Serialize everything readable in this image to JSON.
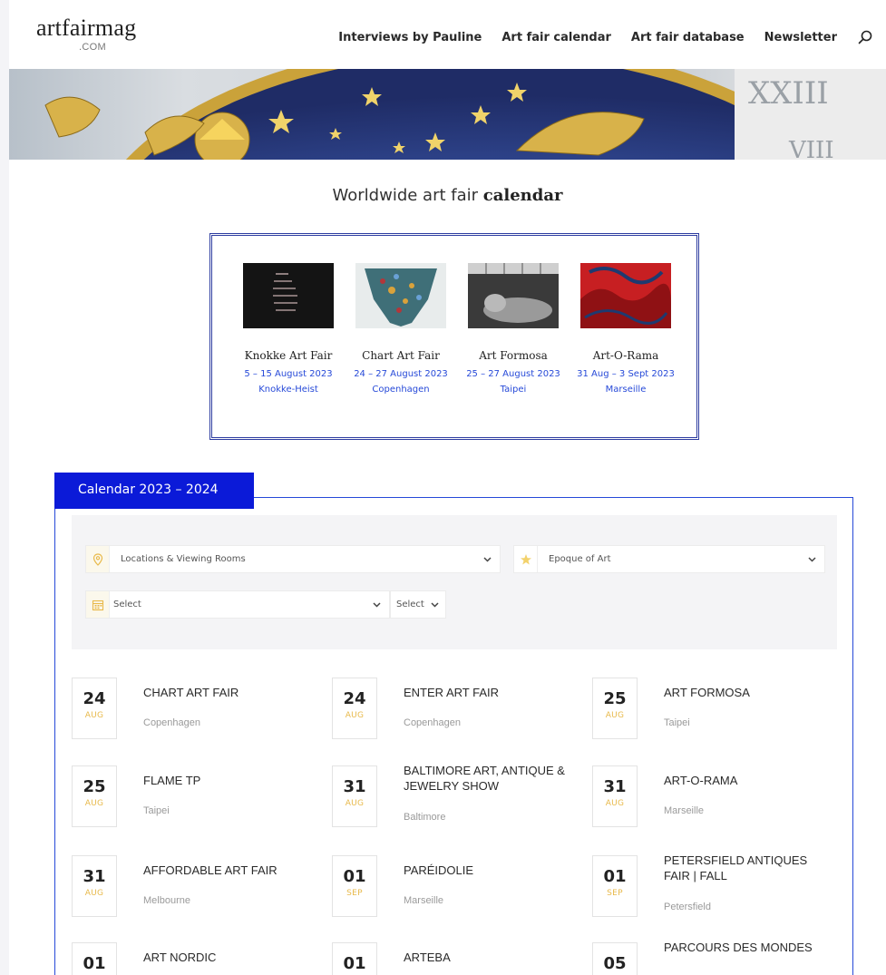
{
  "header": {
    "logo": "artfairmag",
    "logo_sub": ".COM",
    "nav": [
      "Interviews by Pauline",
      "Art fair calendar",
      "Art fair database",
      "Newsletter"
    ]
  },
  "section": {
    "title_prefix": "Worldwide art fair ",
    "title_bold": "calendar"
  },
  "featured": [
    {
      "title": "Knokke Art Fair",
      "dates": "5 – 15 August 2023",
      "location": "Knokke-Heist"
    },
    {
      "title": "Chart Art Fair",
      "dates": "24 – 27 August 2023",
      "location": "Copenhagen"
    },
    {
      "title": "Art Formosa",
      "dates": "25 – 27 August 2023",
      "location": "Taipei"
    },
    {
      "title": "Art-O-Rama",
      "dates": "31 Aug – 3 Sept 2023",
      "location": "Marseille"
    }
  ],
  "calendar": {
    "tab_label": "Calendar 2023 – 2024",
    "filters": {
      "location": "Locations & Viewing Rooms",
      "epoque": "Epoque of Art",
      "month": "Select",
      "year": "Select"
    },
    "events": [
      {
        "day": "24",
        "month": "AUG",
        "title": "CHART ART FAIR",
        "city": "Copenhagen"
      },
      {
        "day": "24",
        "month": "AUG",
        "title": "ENTER ART FAIR",
        "city": "Copenhagen"
      },
      {
        "day": "25",
        "month": "AUG",
        "title": "ART FORMOSA",
        "city": "Taipei"
      },
      {
        "day": "25",
        "month": "AUG",
        "title": "FLAME TP",
        "city": "Taipei"
      },
      {
        "day": "31",
        "month": "AUG",
        "title": "BALTIMORE ART, ANTIQUE & JEWELRY SHOW",
        "city": "Baltimore"
      },
      {
        "day": "31",
        "month": "AUG",
        "title": "ART-O-RAMA",
        "city": "Marseille"
      },
      {
        "day": "31",
        "month": "AUG",
        "title": "AFFORDABLE ART FAIR",
        "city": "Melbourne"
      },
      {
        "day": "01",
        "month": "SEP",
        "title": "PARÉIDOLIE",
        "city": "Marseille"
      },
      {
        "day": "01",
        "month": "SEP",
        "title": "PETERSFIELD ANTIQUES FAIR | FALL",
        "city": "Petersfield"
      },
      {
        "day": "01",
        "month": "",
        "title": "ART NORDIC",
        "city": ""
      },
      {
        "day": "01",
        "month": "",
        "title": "ARTEBA",
        "city": ""
      },
      {
        "day": "05",
        "month": "",
        "title": "PARCOURS DES MONDES",
        "city": ""
      }
    ]
  },
  "colors": {
    "accent_blue": "#0b1ad8",
    "link_blue": "#2649d8",
    "month_gold": "#e8b94a"
  },
  "icons": [
    "search-icon",
    "location-pin-icon",
    "pin-star-icon",
    "calendar-icon",
    "chevron-down-icon"
  ]
}
